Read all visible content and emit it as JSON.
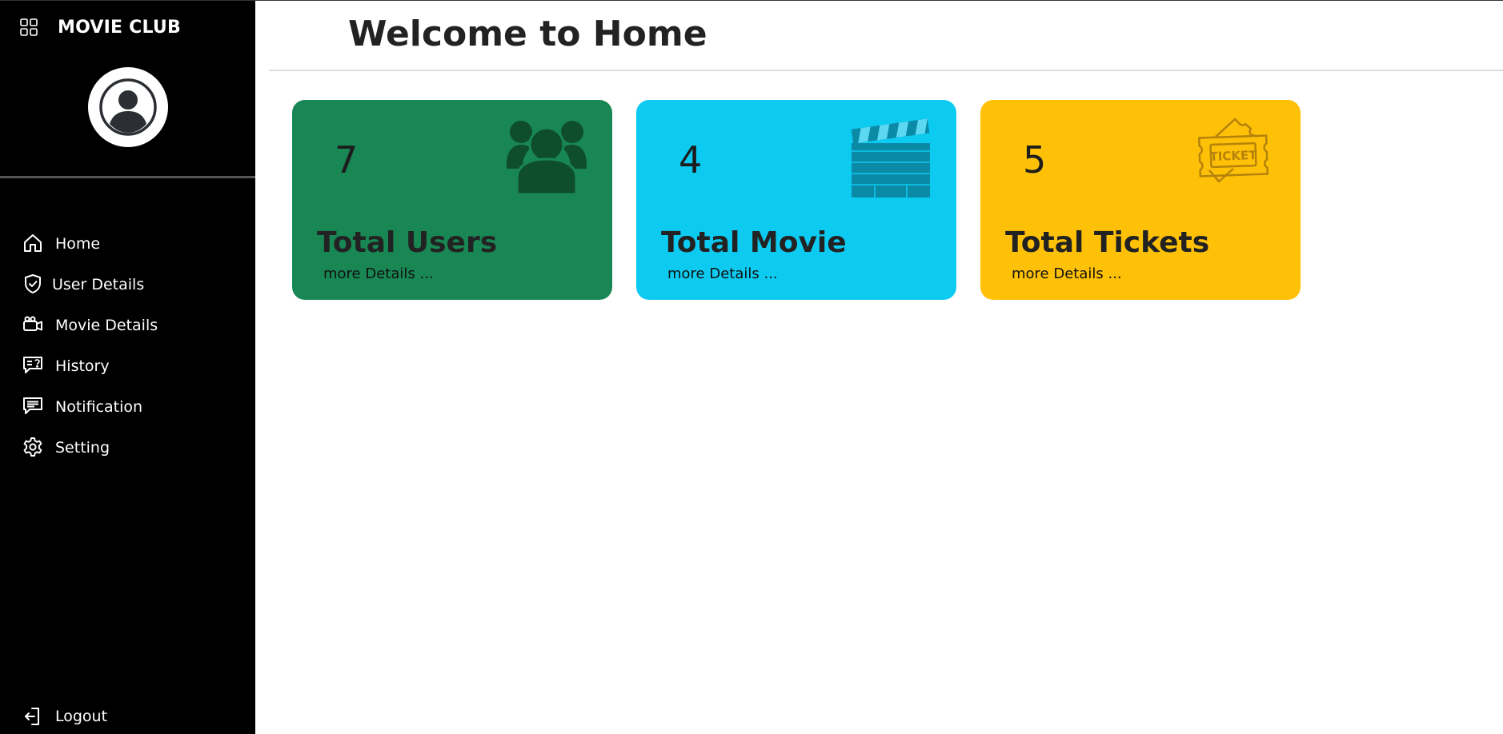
{
  "app": {
    "brand": "MOVIE CLUB"
  },
  "sidebar": {
    "items": [
      {
        "label": "Home",
        "icon": "home-icon"
      },
      {
        "label": "User Details",
        "icon": "shield-check-icon"
      },
      {
        "label": "Movie Details",
        "icon": "camera-icon"
      },
      {
        "label": "History",
        "icon": "chat-question-icon"
      },
      {
        "label": "Notification",
        "icon": "chat-lines-icon"
      },
      {
        "label": "Setting",
        "icon": "gear-icon"
      }
    ],
    "logout": {
      "label": "Logout",
      "icon": "logout-icon"
    }
  },
  "header": {
    "title": "Welcome to Home"
  },
  "cards": [
    {
      "count": "7",
      "title": "Total Users",
      "more": "more Details ...",
      "color": "#198754",
      "icon": "users-icon"
    },
    {
      "count": "4",
      "title": "Total Movie",
      "more": "more Details ...",
      "color": "#0dcaf0",
      "icon": "clapperboard-icon"
    },
    {
      "count": "5",
      "title": "Total Tickets",
      "more": "more Details ...",
      "color": "#ffc107",
      "icon": "ticket-icon"
    }
  ]
}
